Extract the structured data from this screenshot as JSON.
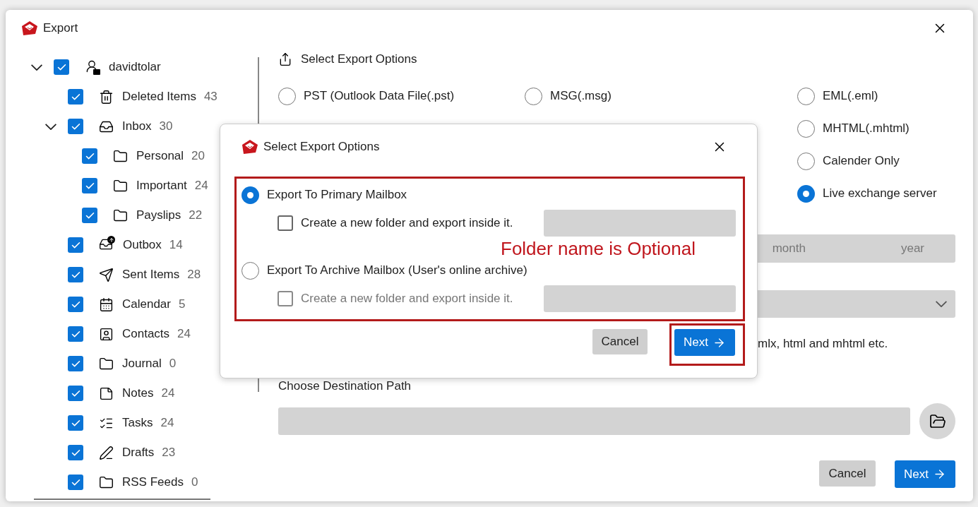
{
  "window": {
    "title": "Export"
  },
  "tree": [
    {
      "label": "davidtolar",
      "kind": "account",
      "checked": true,
      "expanded": true,
      "children": [
        {
          "label": "Deleted Items",
          "count": "43",
          "kind": "trash",
          "checked": true
        },
        {
          "label": "Inbox",
          "count": "30",
          "kind": "inbox",
          "checked": true,
          "expanded": true,
          "children": [
            {
              "label": "Personal",
              "count": "20",
              "kind": "folder",
              "checked": true
            },
            {
              "label": "Important",
              "count": "24",
              "kind": "folder",
              "checked": true
            },
            {
              "label": "Payslips",
              "count": "22",
              "kind": "folder",
              "checked": true
            }
          ]
        },
        {
          "label": "Outbox",
          "count": "14",
          "kind": "outbox",
          "checked": true
        },
        {
          "label": "Sent Items",
          "count": "28",
          "kind": "send",
          "checked": true
        },
        {
          "label": "Calendar",
          "count": "5",
          "kind": "calendar",
          "checked": true
        },
        {
          "label": "Contacts",
          "count": "24",
          "kind": "contact",
          "checked": true
        },
        {
          "label": "Journal",
          "count": "0",
          "kind": "folder",
          "checked": true
        },
        {
          "label": "Notes",
          "count": "24",
          "kind": "note",
          "checked": true
        },
        {
          "label": "Tasks",
          "count": "24",
          "kind": "tasks",
          "checked": true
        },
        {
          "label": "Drafts",
          "count": "23",
          "kind": "pen",
          "checked": true
        },
        {
          "label": "RSS Feeds",
          "count": "0",
          "kind": "folder",
          "checked": true
        }
      ]
    }
  ],
  "export_options": {
    "title": "Select Export Options",
    "columns": [
      [
        {
          "label": "PST (Outlook Data File(.pst)",
          "selected": false
        }
      ],
      [
        {
          "label": "MSG(.msg)",
          "selected": false
        }
      ],
      [
        {
          "label": "EML(.eml)",
          "selected": false
        },
        {
          "label": "MHTML(.mhtml)",
          "selected": false
        },
        {
          "label": "Calender Only",
          "selected": false
        },
        {
          "label": "Live exchange server",
          "selected": true
        }
      ]
    ],
    "date_placeholders": [
      "month",
      "year"
    ],
    "note": "mlx, html and mhtml etc.",
    "destination_label": "Choose Destination Path",
    "buttons": [
      {
        "label": "Cancel",
        "kind": "secondary"
      },
      {
        "label": "Next",
        "kind": "primary"
      }
    ]
  },
  "dialog": {
    "title": "Select Export Options",
    "options": [
      {
        "label": "Export To Primary Mailbox",
        "selected": true,
        "subfolder": {
          "label": "Create a new folder and export inside it.",
          "checked": false,
          "disabled": false
        }
      },
      {
        "label": "Export To Archive Mailbox (User's online archive)",
        "selected": false,
        "subfolder": {
          "label": "Create a new folder and export inside it.",
          "checked": false,
          "disabled": true
        }
      }
    ],
    "annotation": "Folder name is Optional",
    "buttons": [
      {
        "label": "Cancel",
        "kind": "secondary"
      },
      {
        "label": "Next",
        "kind": "primary"
      }
    ]
  }
}
